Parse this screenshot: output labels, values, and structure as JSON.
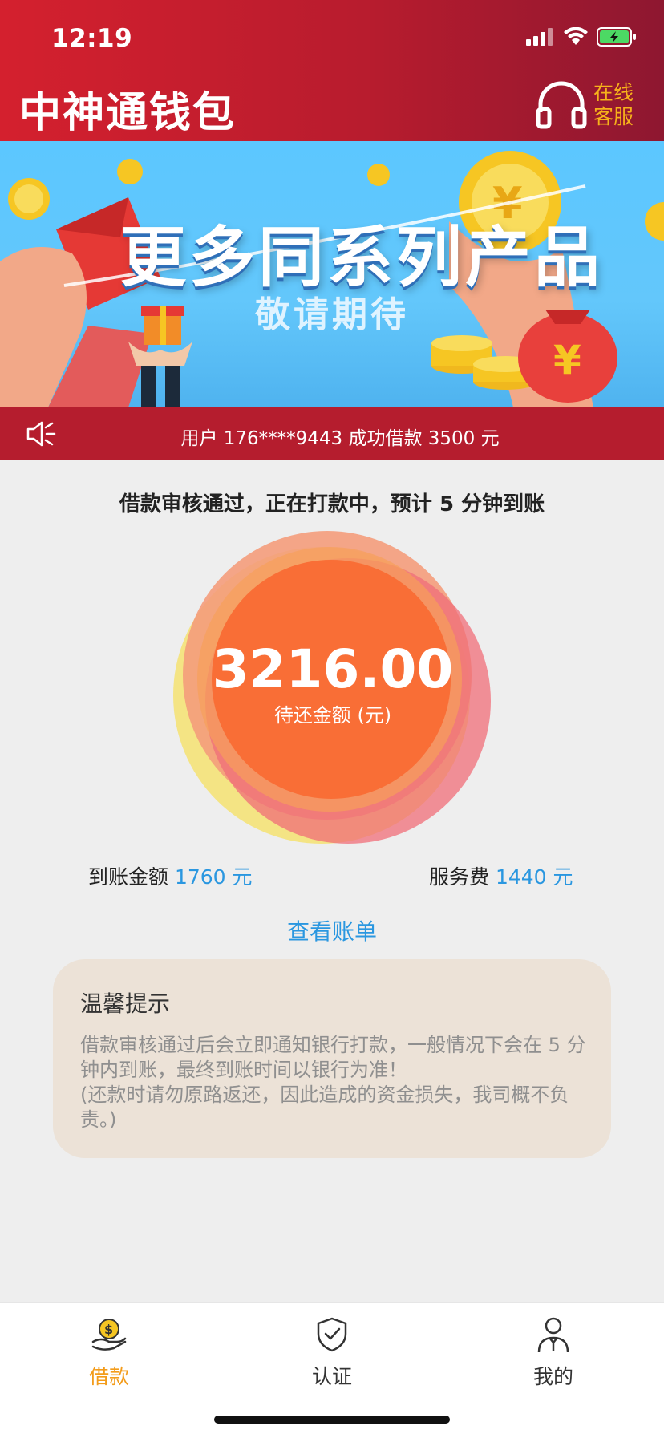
{
  "status_bar": {
    "time": "12:19"
  },
  "header": {
    "title": "中神通钱包",
    "customer_service_label": "在线客服"
  },
  "banner": {
    "title": "更多同系列产品",
    "subtitle": "敬请期待"
  },
  "notice": {
    "text": "用户 176****9443 成功借款 3500 元"
  },
  "loan": {
    "status_message": "借款审核通过，正在打款中，预计 5 分钟到账",
    "amount": "3216.00",
    "amount_label": "待还金额 (元)",
    "received_label": "到账金额",
    "received_value": "1760 元",
    "fee_label": "服务费",
    "fee_value": "1440 元",
    "view_bill": "查看账单"
  },
  "tips": {
    "title": "温馨提示",
    "body": "借款审核通过后会立即通知银行打款，一般情况下会在 5 分钟内到账，最终到账时间以银行为准！\n(还款时请勿原路返还，因此造成的资金损失，我司概不负责。)"
  },
  "tabbar": {
    "items": [
      {
        "label": "借款",
        "icon": "money-hand-icon",
        "active": true
      },
      {
        "label": "认证",
        "icon": "shield-check-icon",
        "active": false
      },
      {
        "label": "我的",
        "icon": "person-icon",
        "active": false
      }
    ]
  },
  "colors": {
    "header_red": "#d4202e",
    "accent_orange": "#f96e36",
    "link_blue": "#2a97e0",
    "active_tab": "#f39c1b"
  }
}
